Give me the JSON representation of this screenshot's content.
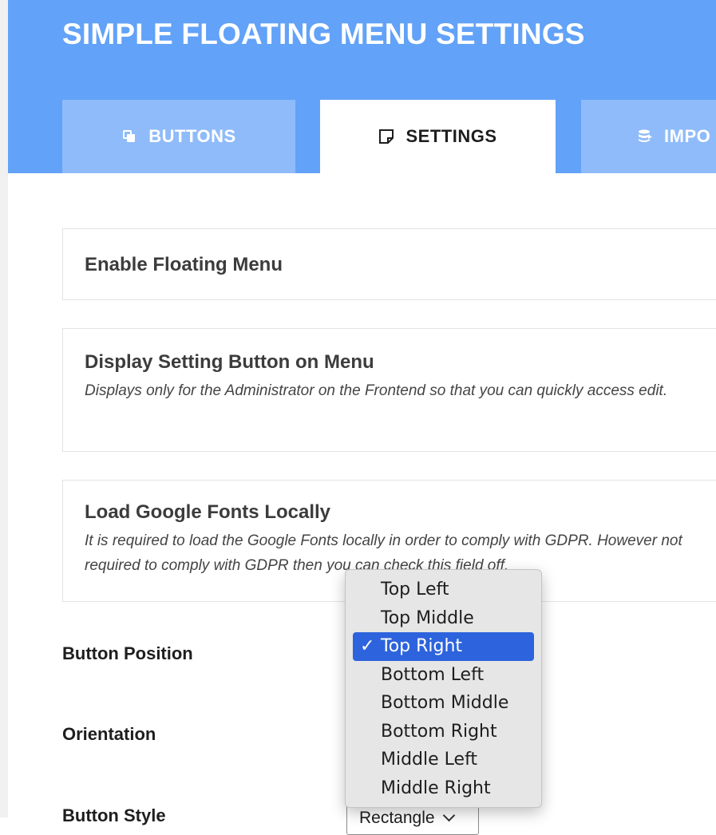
{
  "header": {
    "title": "SIMPLE FLOATING MENU SETTINGS",
    "tabs": [
      {
        "label": "BUTTONS",
        "icon": "copy-icon"
      },
      {
        "label": "SETTINGS",
        "icon": "edit-note-icon",
        "active": true
      },
      {
        "label": "IMPO",
        "icon": "database-import-icon"
      }
    ]
  },
  "colors": {
    "header_bg": "#62a2f8",
    "tab_inactive_bg": "#8fbbfa",
    "selection_blue": "#2d63dc"
  },
  "settings": {
    "enable_menu": {
      "title": "Enable Floating Menu"
    },
    "display_setting_button": {
      "title": "Display Setting Button on Menu",
      "description": "Displays only for the Administrator on the Frontend so that you can quickly access edit."
    },
    "load_fonts_locally": {
      "title": "Load Google Fonts Locally",
      "description": "It is required to load the Google Fonts locally in order to comply with GDPR. However not required to comply with GDPR then you can check this field off."
    }
  },
  "fields": {
    "button_position": {
      "label": "Button Position"
    },
    "orientation": {
      "label": "Orientation"
    },
    "button_style": {
      "label": "Button Style",
      "value": "Rectangle"
    }
  },
  "dropdown": {
    "check_mark": "✓",
    "selected": "Top Right",
    "options": [
      "Top Left",
      "Top Middle",
      "Top Right",
      "Bottom Left",
      "Bottom Middle",
      "Bottom Right",
      "Middle Left",
      "Middle Right"
    ]
  }
}
